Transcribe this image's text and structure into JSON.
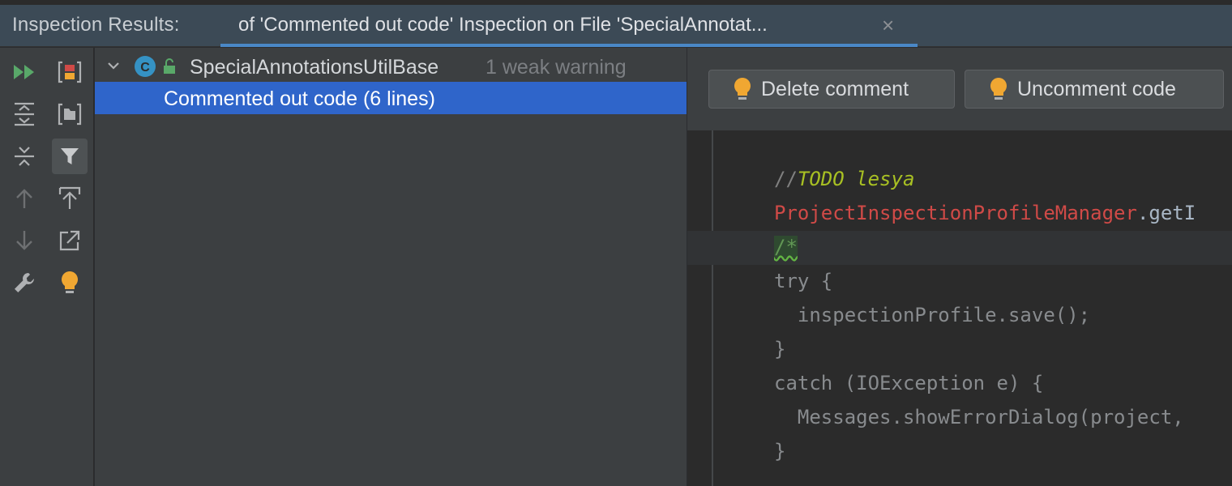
{
  "title_bar": {
    "label": "Inspection Results:",
    "tab_title": "of 'Commented out code' Inspection on File 'SpecialAnnotat...",
    "close_glyph": "×"
  },
  "toolbar": {
    "buttons_col1": [
      "rerun-icon",
      "expand-all-icon",
      "collapse-all-icon",
      "previous-occurrence-icon",
      "next-occurrence-icon",
      "settings-wrench-icon"
    ],
    "buttons_col2": [
      "group-by-severity-icon",
      "group-by-directory-icon",
      "filter-icon",
      "export-icon",
      "autoscroll-to-source-icon",
      "quick-fix-bulb-icon"
    ],
    "active_button": "filter-icon"
  },
  "tree": {
    "file_node": {
      "name": "SpecialAnnotationsUtilBase",
      "problem_count": "1 weak warning",
      "icon": "java-class-icon"
    },
    "problem_node": {
      "label": "Commented out code (6 lines)",
      "selected": true
    }
  },
  "fixes": {
    "delete_label": "Delete comment",
    "uncomment_label": "Uncomment code"
  },
  "code": {
    "comment_prefix": "//",
    "todo_text": "TODO lesya",
    "line_manager_class": "ProjectInspectionProfileManager",
    "line_manager_rest": ".getI",
    "block_open": "/*",
    "try_line": "try {",
    "save_line": "  inspectionProfile.save();",
    "close_brace_1": "}",
    "catch_line": "catch (IOException e) {",
    "messages_line": "  Messages.showErrorDialog(project,",
    "close_brace_2": "}"
  },
  "colors": {
    "selection": "#2f65ca",
    "tab_underline": "#4a88c7",
    "run_green": "#59a869",
    "bulb_yellow": "#f0a732",
    "todo_green": "#a8c023",
    "class_red": "#d04a47"
  }
}
